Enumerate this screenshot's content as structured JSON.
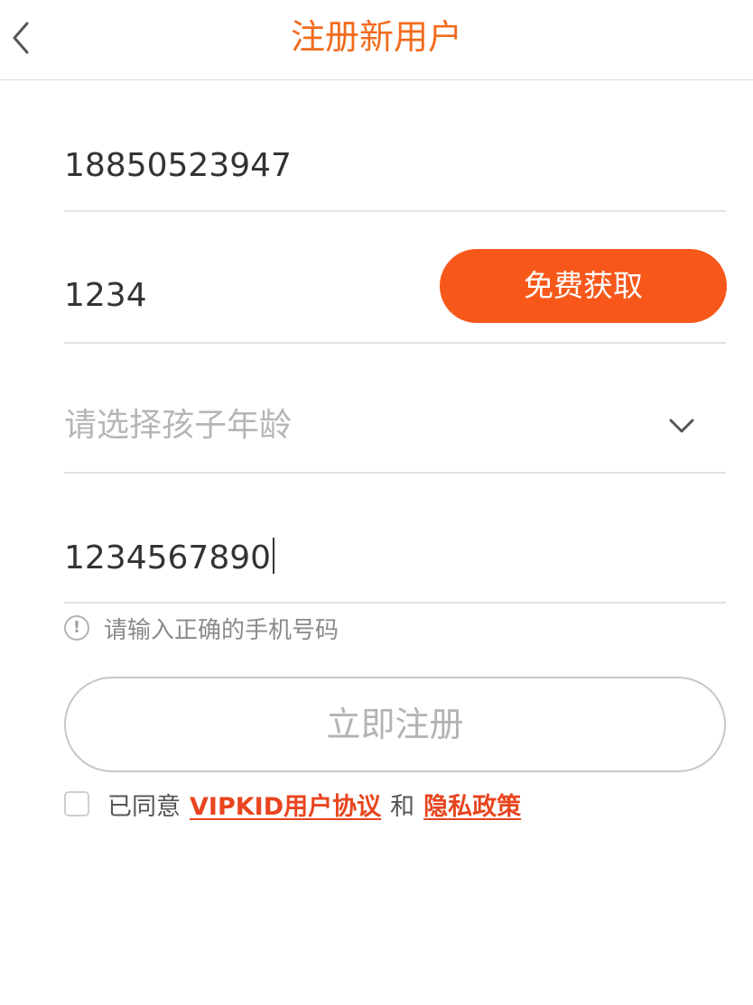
{
  "header": {
    "title": "注册新用户"
  },
  "form": {
    "phone_value": "18850523947",
    "code_value": "1234",
    "get_code_label": "免费获取",
    "age_placeholder": "请选择孩子年龄",
    "mobile_value": "1234567890",
    "error_message": "请输入正确的手机号码",
    "error_icon_glyph": "!",
    "submit_label": "立即注册"
  },
  "agreement": {
    "prefix": "已同意",
    "user_agreement_link": "VIPKID用户协议",
    "conjunction": "和",
    "privacy_link": "隐私政策"
  },
  "colors": {
    "accent": "#f26b1d",
    "button": "#f7581a",
    "link": "#e8451f"
  },
  "icons": {
    "back": "chevron-left-icon",
    "dropdown": "chevron-down-icon",
    "error": "exclamation-circle-icon"
  }
}
